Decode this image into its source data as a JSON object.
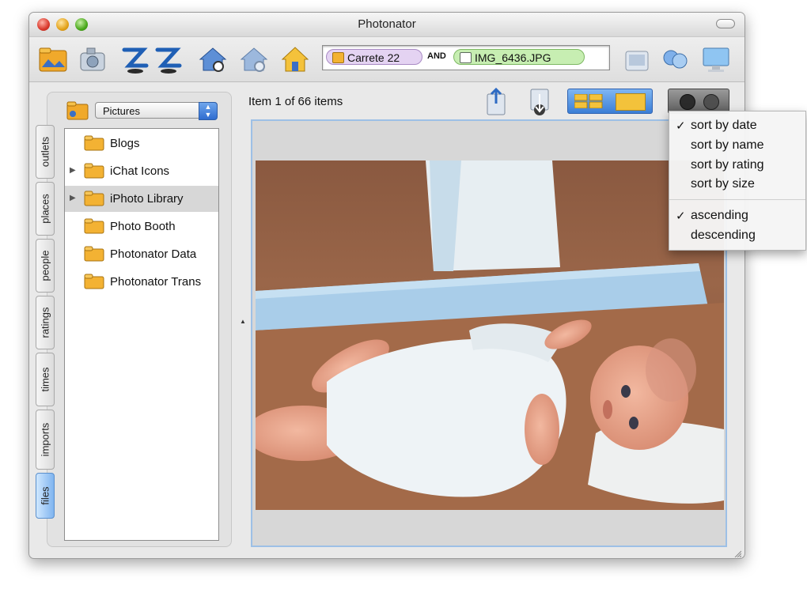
{
  "window": {
    "title": "Photonator"
  },
  "toolbar": {
    "icons": [
      "folder-icon",
      "camera-icon",
      "sort-za-icon",
      "sort-az-icon",
      "home-search-icon",
      "home-add-icon",
      "home-icon",
      "album-icon",
      "sync-icon",
      "display-icon"
    ],
    "search": {
      "token_1": "Carrete 22",
      "operator": "AND",
      "token_2": "IMG_6436.JPG"
    }
  },
  "sidebar": {
    "source": "Pictures",
    "tabs": [
      "outlets",
      "places",
      "people",
      "ratings",
      "times",
      "imports",
      "files"
    ],
    "active_tab": "files",
    "files": [
      {
        "label": "Blogs",
        "expandable": false
      },
      {
        "label": "iChat Icons",
        "expandable": true
      },
      {
        "label": "iPhoto Library",
        "expandable": true,
        "selected": true
      },
      {
        "label": "Photo Booth",
        "expandable": false
      },
      {
        "label": "Photonator Data",
        "expandable": false
      },
      {
        "label": "Photonator Trans",
        "expandable": false
      }
    ]
  },
  "main": {
    "item_count": "Item 1 of 66 items"
  },
  "sort_menu": {
    "items": [
      {
        "label": "sort by date",
        "checked": true
      },
      {
        "label": "sort by name",
        "checked": false
      },
      {
        "label": "sort by rating",
        "checked": false
      },
      {
        "label": "sort by size",
        "checked": false
      },
      {
        "label": "ascending",
        "checked": true
      },
      {
        "label": "descending",
        "checked": false
      }
    ],
    "check_glyph": "✓"
  },
  "colors": {
    "accent_blue": "#3b7ed6",
    "folder_yellow": "#f3c23b",
    "token_purple": "#e4d3f2",
    "token_green": "#c7eeb2"
  }
}
